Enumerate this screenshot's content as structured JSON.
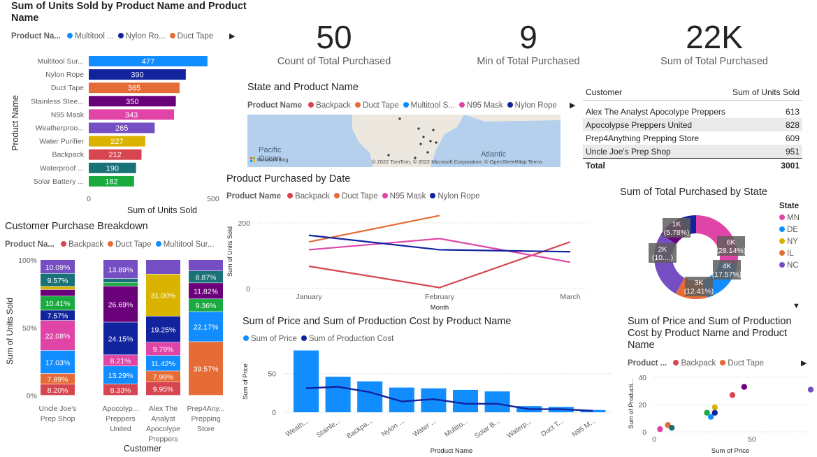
{
  "bar_chart": {
    "title": "Sum of Units Sold by Product Name and Product Name",
    "legend_title": "Product Na...",
    "legend": [
      {
        "label": "Multitool ...",
        "color": "#118DFF"
      },
      {
        "label": "Nylon Ro...",
        "color": "#12239E"
      },
      {
        "label": "Duct Tape",
        "color": "#E66C37"
      }
    ],
    "chart_data": {
      "type": "bar",
      "categories": [
        "Multitool Sur...",
        "Nylon Rope",
        "Duct Tape",
        "Stainless Stee...",
        "N95 Mask",
        "Weatherproo...",
        "Water Purifier",
        "Backpack",
        "Waterproof ...",
        "Solar Battery ..."
      ],
      "values": [
        477,
        390,
        365,
        350,
        343,
        265,
        227,
        212,
        190,
        182
      ],
      "colors": [
        "#118DFF",
        "#12239E",
        "#E66C37",
        "#6B007B",
        "#E044A7",
        "#744EC2",
        "#D9B300",
        "#D64550",
        "#197278",
        "#1AAB40"
      ],
      "xlabel": "Sum of Units Sold",
      "ylabel": "Product Name",
      "xticks": [
        "0",
        "500"
      ],
      "xlim": [
        0,
        500
      ]
    }
  },
  "cards": [
    {
      "value": "50",
      "label": "Count of Total Purchased"
    },
    {
      "value": "9",
      "label": "Min of Total Purchased"
    },
    {
      "value": "22K",
      "label": "Sum of Total Purchased"
    }
  ],
  "map": {
    "title": "State and Product Name",
    "legend_title": "Product Name",
    "legend": [
      {
        "label": "Backpack",
        "color": "#D64550"
      },
      {
        "label": "Duct Tape",
        "color": "#E66C37"
      },
      {
        "label": "Multitool S...",
        "color": "#118DFF"
      },
      {
        "label": "N95 Mask",
        "color": "#E044A7"
      },
      {
        "label": "Nylon Rope",
        "color": "#12239E"
      }
    ],
    "labels": {
      "pacific": "Pacific",
      "ocean": "Ocean",
      "atlantic": "Atlantic",
      "bing": "Microsoft Bing"
    },
    "attribution": "© 2022 TomTom, © 2022 Microsoft Corporation, © OpenStreetMap  Terms"
  },
  "table": {
    "headers": [
      "Customer",
      "Sum of Units Sold"
    ],
    "rows": [
      {
        "customer": "Alex The Analyst Apocolype Preppers",
        "units": "613"
      },
      {
        "customer": "Apocolypse Preppers United",
        "units": "828"
      },
      {
        "customer": "Prep4Anything Prepping Store",
        "units": "609"
      },
      {
        "customer": "Uncle Joe's Prep Shop",
        "units": "951"
      }
    ],
    "total_label": "Total",
    "total_value": "3001"
  },
  "line_chart": {
    "title": "Product Purchased by Date",
    "legend_title": "Product Name",
    "legend": [
      {
        "label": "Backpack",
        "color": "#D64550"
      },
      {
        "label": "Duct Tape",
        "color": "#E66C37"
      },
      {
        "label": "N95 Mask",
        "color": "#E044A7"
      },
      {
        "label": "Nylon Rope",
        "color": "#12239E"
      }
    ],
    "chart_data": {
      "type": "line",
      "x": [
        "January",
        "February",
        "March"
      ],
      "series": [
        {
          "name": "Backpack",
          "values": [
            68,
            3,
            142
          ],
          "color": "#D64550"
        },
        {
          "name": "Duct Tape",
          "values": [
            142,
            222,
            null
          ],
          "color": "#E66C37"
        },
        {
          "name": "N95 Mask",
          "values": [
            118,
            152,
            80
          ],
          "color": "#E044A7"
        },
        {
          "name": "Nylon Rope",
          "values": [
            162,
            118,
            112
          ],
          "color": "#12239E"
        }
      ],
      "xlabel": "Month",
      "ylabel": "Sum of Units Sold",
      "yticks": [
        "0",
        "200"
      ],
      "ylim": [
        0,
        240
      ]
    }
  },
  "donut": {
    "title": "Sum of Total Purchased by State",
    "legend_title": "State",
    "legend": [
      {
        "label": "MN",
        "color": "#E044A7"
      },
      {
        "label": "DE",
        "color": "#118DFF"
      },
      {
        "label": "NY",
        "color": "#D9B300"
      },
      {
        "label": "IL",
        "color": "#E66C37"
      },
      {
        "label": "NC",
        "color": "#744EC2"
      }
    ],
    "chart_data": {
      "type": "pie",
      "slices": [
        {
          "state": "MN",
          "value": 6,
          "label": "6K",
          "pct": "(28.14%)",
          "color": "#E044A7"
        },
        {
          "state": "DE",
          "value": 4,
          "label": "4K",
          "pct": "(17.57%)",
          "color": "#118DFF"
        },
        {
          "state": "NY",
          "value": 3,
          "label": "3K",
          "pct": "(12.41%)",
          "color": "#E66C37"
        },
        {
          "state": "IL",
          "value": 2,
          "label": "2K",
          "pct": "(10....)",
          "color": "#6B007B"
        },
        {
          "state": "NC",
          "value": 1,
          "label": "1K",
          "pct": "(5.78%)",
          "color": "#12239E"
        }
      ],
      "other_segments": [
        {
          "value": 26.1,
          "color": "#744EC2"
        }
      ]
    }
  },
  "stacked": {
    "title": "Customer Purchase Breakdown",
    "legend_title": "Product Na...",
    "legend": [
      {
        "label": "Backpack",
        "color": "#D64550"
      },
      {
        "label": "Duct Tape",
        "color": "#E66C37"
      },
      {
        "label": "Multitool Sur...",
        "color": "#118DFF"
      }
    ],
    "chart_data": {
      "type": "bar",
      "stacked": "100%",
      "categories": [
        "Uncle Joe's Prep Shop",
        "Apocolyp... Preppers United",
        "Alex The Analyst Apocolype Preppers",
        "Prep4Any... Prepping Store"
      ],
      "category_lines": [
        [
          "Uncle Joe's",
          "Prep Shop"
        ],
        [
          "Apocolyp...",
          "Preppers",
          "United"
        ],
        [
          "Alex The",
          "Analyst",
          "Apocolype",
          "Preppers"
        ],
        [
          "Prep4Any...",
          "Prepping",
          "Store"
        ]
      ],
      "segments": [
        [
          {
            "v": 8.2,
            "c": "#D64550",
            "label": "8.20%"
          },
          {
            "v": 7.89,
            "c": "#E66C37",
            "label": "7.89%"
          },
          {
            "v": 17.03,
            "c": "#118DFF",
            "label": "17.03%"
          },
          {
            "v": 22.08,
            "c": "#E044A7",
            "label": "22.08%"
          },
          {
            "v": 7.57,
            "c": "#12239E",
            "label": "7.57%"
          },
          {
            "v": 10.41,
            "c": "#1AAB40",
            "label": "10.41%"
          },
          {
            "v": 4.8,
            "c": "#6B007B",
            "label": ""
          },
          {
            "v": 2.36,
            "c": "#D9B300",
            "label": ""
          },
          {
            "v": 9.57,
            "c": "#197278",
            "label": "9.57%"
          },
          {
            "v": 10.09,
            "c": "#744EC2",
            "label": "10.09%"
          }
        ],
        [
          {
            "v": 8.33,
            "c": "#D64550",
            "label": "8.33%"
          },
          {
            "v": 13.29,
            "c": "#118DFF",
            "label": "13.29%"
          },
          {
            "v": 8.21,
            "c": "#E044A7",
            "label": "8.21%"
          },
          {
            "v": 24.15,
            "c": "#12239E",
            "label": "24.15%"
          },
          {
            "v": 26.69,
            "c": "#6B007B",
            "label": "26.69%"
          },
          {
            "v": 2.5,
            "c": "#1AAB40",
            "label": ""
          },
          {
            "v": 2.94,
            "c": "#197278",
            "label": ""
          },
          {
            "v": 13.89,
            "c": "#744EC2",
            "label": "13.89%"
          }
        ],
        [
          {
            "v": 9.95,
            "c": "#D64550",
            "label": "9.95%"
          },
          {
            "v": 7.99,
            "c": "#E66C37",
            "label": "7.99%"
          },
          {
            "v": 11.42,
            "c": "#118DFF",
            "label": "11.42%"
          },
          {
            "v": 9.79,
            "c": "#E044A7",
            "label": "9.79%"
          },
          {
            "v": 19.25,
            "c": "#12239E",
            "label": "19.25%"
          },
          {
            "v": 31.0,
            "c": "#D9B300",
            "label": "31.00%"
          },
          {
            "v": 10.6,
            "c": "#744EC2",
            "label": ""
          }
        ],
        [
          {
            "v": 39.57,
            "c": "#E66C37",
            "label": "39.57%"
          },
          {
            "v": 22.17,
            "c": "#118DFF",
            "label": "22.17%"
          },
          {
            "v": 9.36,
            "c": "#1AAB40",
            "label": "9.36%"
          },
          {
            "v": 11.82,
            "c": "#6B007B",
            "label": "11.82%"
          },
          {
            "v": 8.87,
            "c": "#197278",
            "label": "8.87%"
          },
          {
            "v": 8.21,
            "c": "#744EC2",
            "label": ""
          }
        ]
      ],
      "xlabel": "Customer",
      "ylabel": "Sum of Units Sold",
      "yticks": [
        "0%",
        "50%",
        "100%"
      ]
    }
  },
  "combo": {
    "title": "Sum of Price and Sum of Production Cost by Product Name",
    "legend": [
      {
        "label": "Sum of Price",
        "color": "#118DFF"
      },
      {
        "label": "Sum of Production Cost",
        "color": "#12239E"
      }
    ],
    "chart_data": {
      "type": "bar",
      "categories": [
        "Weath...",
        "Stainle...",
        "Backpa...",
        "Nylon ...",
        "Water ...",
        "Multito...",
        "Solar B...",
        "Waterp...",
        "Duct T...",
        "N95 M..."
      ],
      "series": [
        {
          "name": "Sum of Price",
          "values": [
            80,
            46,
            40,
            32,
            31,
            29,
            27,
            8,
            7,
            3
          ]
        },
        {
          "name": "Sum of Production Cost",
          "values": [
            31,
            33,
            26,
            14,
            17,
            11,
            11,
            4,
            4,
            2
          ]
        }
      ],
      "xlabel": "Product Name",
      "ylabel": "Sum of Price",
      "yticks": [
        "0",
        "50"
      ],
      "ylim": [
        0,
        85
      ]
    }
  },
  "scatter": {
    "title": "Sum of Price and Sum of Production Cost by Product Name and Product Name",
    "legend_title": "Product ...",
    "legend": [
      {
        "label": "Backpack",
        "color": "#D64550"
      },
      {
        "label": "Duct Tape",
        "color": "#E66C37"
      }
    ],
    "chart_data": {
      "type": "scatter",
      "points": [
        {
          "x": 3,
          "y": 2,
          "c": "#E044A7"
        },
        {
          "x": 7,
          "y": 5,
          "c": "#E66C37"
        },
        {
          "x": 9,
          "y": 3,
          "c": "#197278"
        },
        {
          "x": 27,
          "y": 14,
          "c": "#1AAB40"
        },
        {
          "x": 29,
          "y": 11,
          "c": "#118DFF"
        },
        {
          "x": 31,
          "y": 18,
          "c": "#D9B300"
        },
        {
          "x": 31,
          "y": 14,
          "c": "#12239E"
        },
        {
          "x": 40,
          "y": 27,
          "c": "#D64550"
        },
        {
          "x": 46,
          "y": 33,
          "c": "#6B007B"
        },
        {
          "x": 80,
          "y": 31,
          "c": "#744EC2"
        }
      ],
      "xlabel": "Sum of Price",
      "ylabel": "Sum of Producti...",
      "xticks": [
        "0",
        "50"
      ],
      "yticks": [
        "0",
        "20",
        "40"
      ],
      "xlim": [
        0,
        80
      ],
      "ylim": [
        0,
        40
      ]
    }
  }
}
